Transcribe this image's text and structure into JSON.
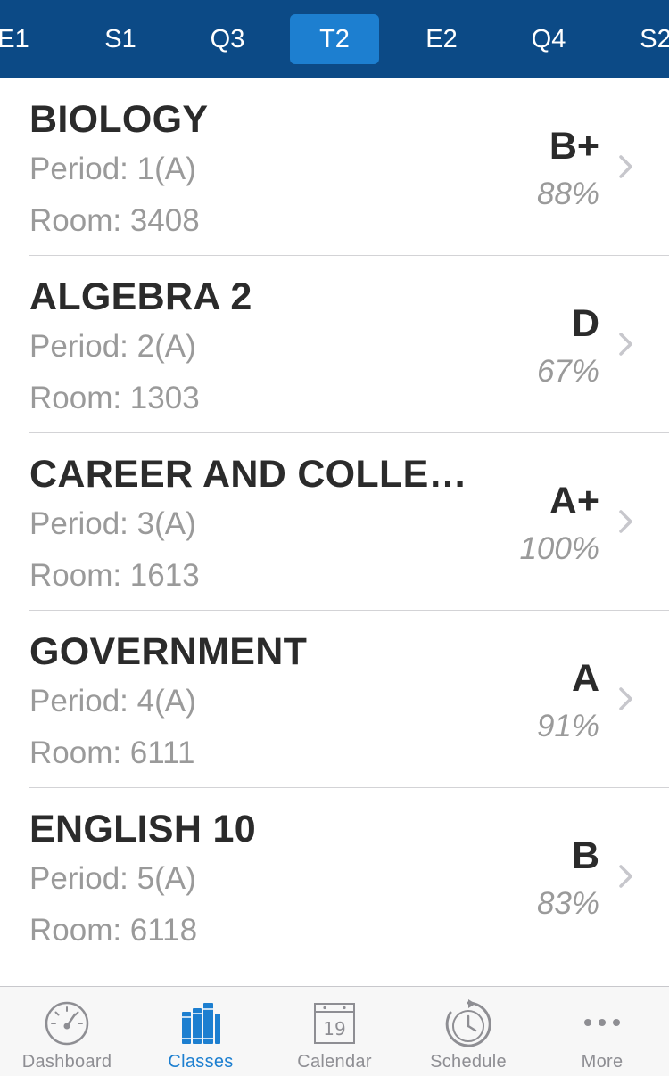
{
  "term_tabs": [
    {
      "label": "E1",
      "active": false
    },
    {
      "label": "S1",
      "active": false
    },
    {
      "label": "Q3",
      "active": false
    },
    {
      "label": "T2",
      "active": true
    },
    {
      "label": "E2",
      "active": false
    },
    {
      "label": "Q4",
      "active": false
    },
    {
      "label": "S2",
      "active": false
    }
  ],
  "classes": [
    {
      "name": "BIOLOGY",
      "period": "Period: 1(A)",
      "room": "Room: 3408",
      "grade": "B+",
      "percent": "88%"
    },
    {
      "name": "ALGEBRA 2",
      "period": "Period: 2(A)",
      "room": "Room: 1303",
      "grade": "D",
      "percent": "67%"
    },
    {
      "name": "CAREER AND COLLEG...",
      "period": "Period: 3(A)",
      "room": "Room: 1613",
      "grade": "A+",
      "percent": "100%"
    },
    {
      "name": "GOVERNMENT",
      "period": "Period: 4(A)",
      "room": "Room: 6111",
      "grade": "A",
      "percent": "91%"
    },
    {
      "name": "ENGLISH 10",
      "period": "Period: 5(A)",
      "room": "Room: 6118",
      "grade": "B",
      "percent": "83%"
    }
  ],
  "bottom_tabs": [
    {
      "label": "Dashboard",
      "icon": "gauge-icon",
      "active": false
    },
    {
      "label": "Classes",
      "icon": "books-icon",
      "active": true
    },
    {
      "label": "Calendar",
      "icon": "calendar-icon",
      "active": false,
      "day": "19"
    },
    {
      "label": "Schedule",
      "icon": "clock-icon",
      "active": false
    },
    {
      "label": "More",
      "icon": "more-icon",
      "active": false
    }
  ],
  "colors": {
    "header_bg": "#0c4a86",
    "active_tab_bg": "#1d7fd0",
    "accent": "#1d7fd0",
    "inactive_icon": "#8e8e93"
  }
}
